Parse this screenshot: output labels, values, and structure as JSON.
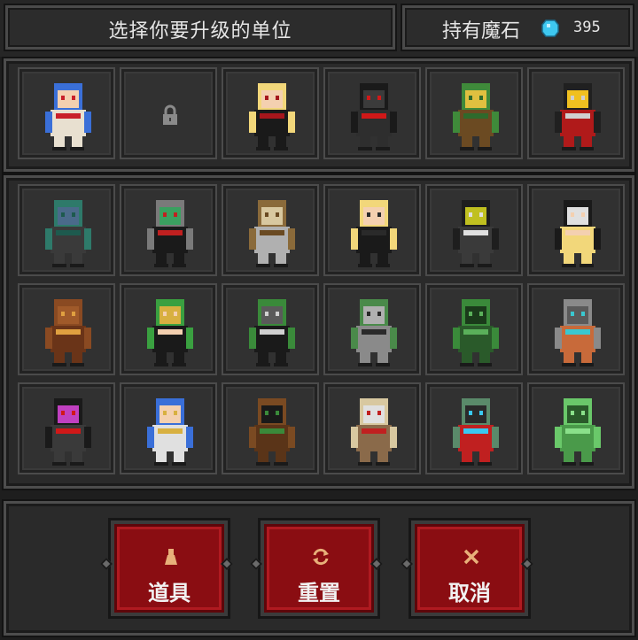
{
  "header": {
    "title": "选择你要升级的单位",
    "currency_label": "持有魔石",
    "currency_icon": "gem-icon",
    "currency_count": "395",
    "currency_color": "#3ec8f0"
  },
  "top_row": [
    {
      "name": "ice-princess-mage",
      "locked": false,
      "colors": [
        "#3a6fd8",
        "#e8e0d0",
        "#c8202a",
        "#f4d0b0"
      ]
    },
    {
      "name": "locked-slot",
      "locked": true,
      "icon": "lock-icon"
    },
    {
      "name": "vampire-girl",
      "locked": false,
      "colors": [
        "#f2d77a",
        "#1a1a1a",
        "#a5161c",
        "#f4d0b0"
      ]
    },
    {
      "name": "shadow-wraith",
      "locked": false,
      "colors": [
        "#1a1a1a",
        "#2e2e2e",
        "#d01818",
        "#3b3b3b"
      ]
    },
    {
      "name": "treant-beast",
      "locked": false,
      "colors": [
        "#3f8a3a",
        "#6b4a22",
        "#2f6a2c",
        "#e0c040"
      ]
    },
    {
      "name": "dark-lich-king",
      "locked": false,
      "colors": [
        "#202020",
        "#b01a1a",
        "#d0d0d0",
        "#f0c020"
      ]
    }
  ],
  "grid": [
    {
      "name": "green-zombie",
      "colors": [
        "#2e7a6a",
        "#3a3a3a",
        "#1d5a4e",
        "#4a6a8a"
      ]
    },
    {
      "name": "skull-warrior",
      "colors": [
        "#7a7a7a",
        "#1a1a1a",
        "#c02020",
        "#3aa060"
      ]
    },
    {
      "name": "horned-minotaur",
      "colors": [
        "#8a6a3a",
        "#b0b0b0",
        "#6a4a22",
        "#d8c8a0"
      ]
    },
    {
      "name": "elf-archer-girl",
      "colors": [
        "#f2d77a",
        "#1a1a1a",
        "#2a2a2a",
        "#f4d0b0"
      ]
    },
    {
      "name": "bat-creature",
      "colors": [
        "#1e1e1e",
        "#3a3a3a",
        "#e0e0e0",
        "#c0c020"
      ]
    },
    {
      "name": "nun-priestess",
      "colors": [
        "#1a1a1a",
        "#f2d77a",
        "#f4d0b0",
        "#e0e0e0"
      ]
    },
    {
      "name": "rock-golem",
      "colors": [
        "#8a4a22",
        "#6a3418",
        "#e0a040",
        "#a05a2a"
      ]
    },
    {
      "name": "green-hair-sorceress",
      "colors": [
        "#3aa040",
        "#1a1a1a",
        "#f4d0b0",
        "#d8b040"
      ]
    },
    {
      "name": "frankenstein",
      "colors": [
        "#3a8a3a",
        "#1a1a1a",
        "#d0d0d0",
        "#5a5a5a"
      ]
    },
    {
      "name": "armored-orc",
      "colors": [
        "#4a8a4a",
        "#8a8a8a",
        "#2a2a2a",
        "#b0b0b0"
      ]
    },
    {
      "name": "green-dragon",
      "colors": [
        "#3a8a3a",
        "#2a5a2a",
        "#5ab05a",
        "#1a3a1a"
      ]
    },
    {
      "name": "steam-robot",
      "colors": [
        "#8a8a8a",
        "#c86a3a",
        "#3ac8d0",
        "#5a5a5a"
      ]
    },
    {
      "name": "hooded-reaper",
      "colors": [
        "#1a1a1a",
        "#3a3a3a",
        "#d01818",
        "#c040c0"
      ]
    },
    {
      "name": "blue-hair-paladin",
      "colors": [
        "#3a6fd8",
        "#e0e0e0",
        "#d8b040",
        "#f4d0b0"
      ]
    },
    {
      "name": "tree-monster",
      "colors": [
        "#7a4a22",
        "#5a3418",
        "#3a8a3a",
        "#1a1a1a"
      ]
    },
    {
      "name": "knight-crusader",
      "colors": [
        "#d8c8a0",
        "#8a6a4a",
        "#c02020",
        "#e0e0e0"
      ]
    },
    {
      "name": "undead-shieldbearer",
      "colors": [
        "#5a8a6a",
        "#c02020",
        "#3ac8f0",
        "#2a2a2a"
      ]
    },
    {
      "name": "green-slime",
      "colors": [
        "#6ac86a",
        "#4a9a4a",
        "#8ae08a",
        "#2a5a2a"
      ]
    }
  ],
  "buttons": {
    "items": {
      "label": "道具",
      "icon": "potion-flask-icon"
    },
    "reset": {
      "label": "重置",
      "icon": "refresh-icon"
    },
    "cancel": {
      "label": "取消",
      "icon": "close-icon"
    }
  }
}
